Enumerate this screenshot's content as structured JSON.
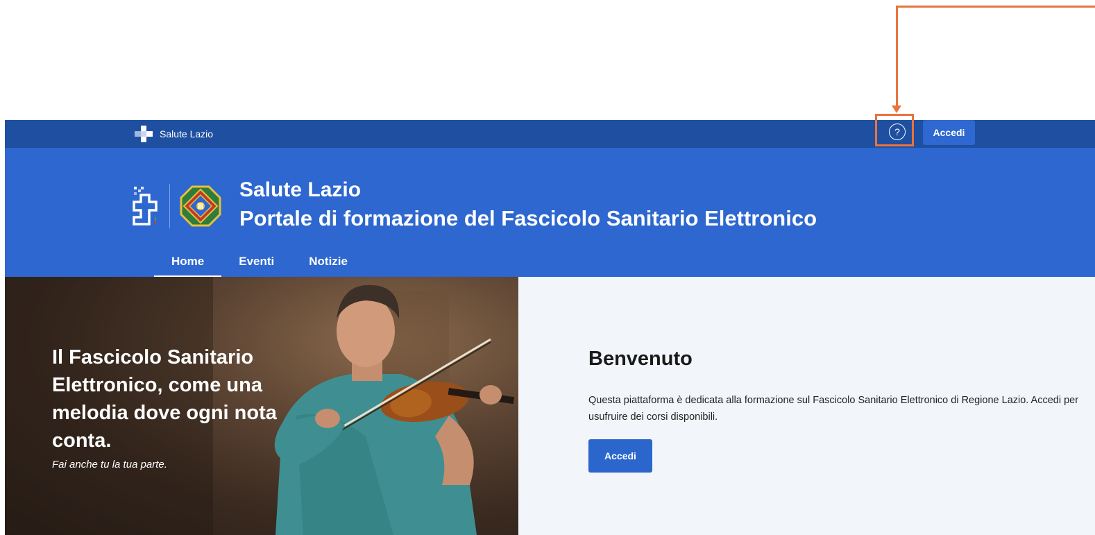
{
  "topbar": {
    "brand_label": "Salute Lazio",
    "help_icon_glyph": "?",
    "login_label": "Accedi"
  },
  "header": {
    "title_line1": "Salute Lazio",
    "title_line2": "Portale di formazione del Fascicolo Sanitario Elettronico"
  },
  "nav": {
    "items": [
      {
        "label": "Home",
        "active": true
      },
      {
        "label": "Eventi",
        "active": false
      },
      {
        "label": "Notizie",
        "active": false
      }
    ]
  },
  "hero": {
    "headline": "Il Fascicolo Sanitario Elettronico, come una melodia dove ogni nota conta.",
    "subline": "Fai anche tu la tua parte."
  },
  "welcome": {
    "title": "Benvenuto",
    "text": "Questa piattaforma è dedicata alla formazione sul Fascicolo Sanitario Elettronico di Regione Lazio. Accedi per usufruire dei corsi disponibili.",
    "button_label": "Accedi"
  },
  "colors": {
    "topbar": "#1f4fa0",
    "header": "#2d67cf",
    "button": "#2a66cc",
    "annotation": "#e8743b",
    "panel_bg": "#f2f5f9"
  },
  "icons": [
    "salute-cross-icon",
    "help-icon",
    "fse-logo-icon",
    "lazio-emblem-icon"
  ]
}
